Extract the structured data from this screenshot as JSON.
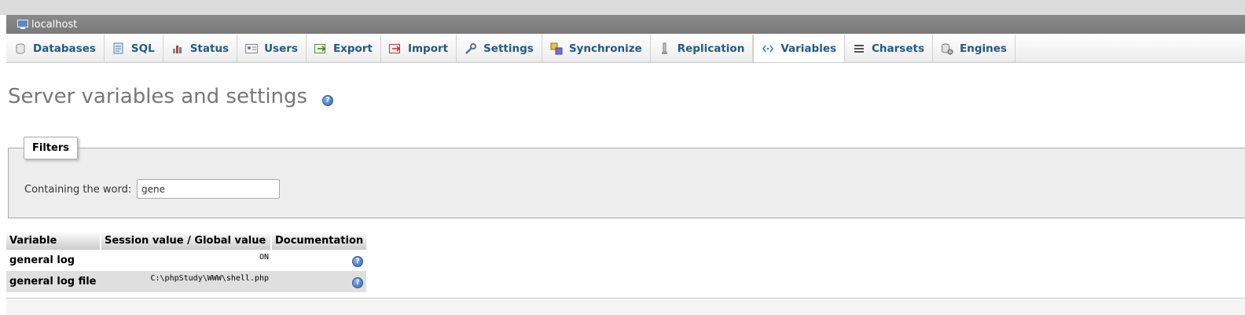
{
  "server": {
    "label": "localhost",
    "icon": "server-icon"
  },
  "tabs": [
    {
      "label": "Databases",
      "icon": "database-icon"
    },
    {
      "label": "SQL",
      "icon": "sql-icon"
    },
    {
      "label": "Status",
      "icon": "status-icon"
    },
    {
      "label": "Users",
      "icon": "users-icon"
    },
    {
      "label": "Export",
      "icon": "export-icon"
    },
    {
      "label": "Import",
      "icon": "import-icon"
    },
    {
      "label": "Settings",
      "icon": "wrench-icon"
    },
    {
      "label": "Synchronize",
      "icon": "synchronize-icon"
    },
    {
      "label": "Replication",
      "icon": "replication-icon"
    },
    {
      "label": "Variables",
      "icon": "variables-icon",
      "active": true
    },
    {
      "label": "Charsets",
      "icon": "charsets-icon"
    },
    {
      "label": "Engines",
      "icon": "engines-icon"
    }
  ],
  "page": {
    "title": "Server variables and settings"
  },
  "filters": {
    "legend": "Filters",
    "label": "Containing the word:",
    "value": "gene"
  },
  "table": {
    "headers": [
      "Variable",
      "Session value / Global value",
      "Documentation"
    ],
    "rows": [
      {
        "name": "general log",
        "value": "ON"
      },
      {
        "name": "general log file",
        "value": "C:\\phpStudy\\WWW\\shell.php"
      }
    ]
  },
  "colors": {
    "link": "#235a81",
    "title": "#777777",
    "serverbar": "#7f7f7f"
  }
}
